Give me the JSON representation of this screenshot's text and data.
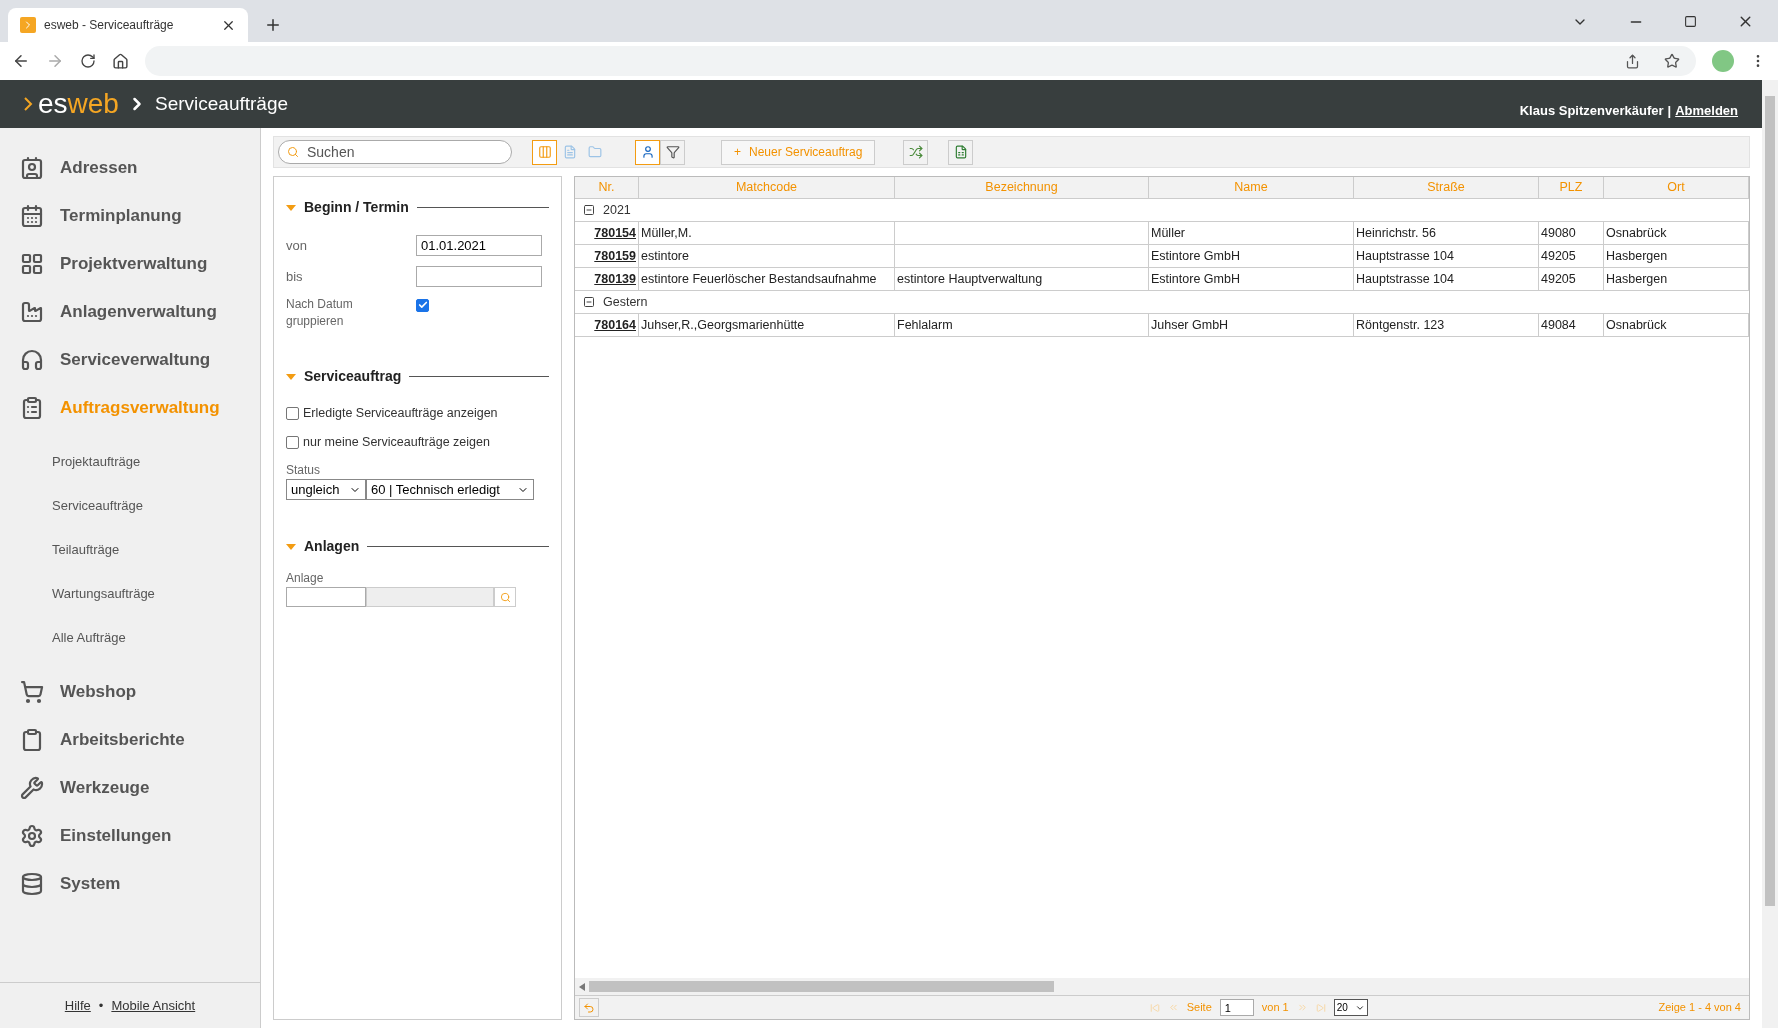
{
  "browser": {
    "tab_title": "esweb - Serviceaufträge"
  },
  "header": {
    "logo_a": "es",
    "logo_b": "web",
    "breadcrumb": "Serviceaufträge",
    "user": "Klaus Spitzenverkäufer",
    "separator": "|",
    "logout": "Abmelden"
  },
  "sidebar": {
    "items": [
      {
        "label": "Adressen",
        "selected": false
      },
      {
        "label": "Terminplanung",
        "selected": false
      },
      {
        "label": "Projektverwaltung",
        "selected": false
      },
      {
        "label": "Anlagenverwaltung",
        "selected": false
      },
      {
        "label": "Serviceverwaltung",
        "selected": false
      },
      {
        "label": "Auftragsverwaltung",
        "selected": true,
        "children": [
          {
            "label": "Projektaufträge"
          },
          {
            "label": "Serviceaufträge"
          },
          {
            "label": "Teilaufträge"
          },
          {
            "label": "Wartungsaufträge"
          },
          {
            "label": "Alle Aufträge"
          }
        ]
      },
      {
        "label": "Webshop",
        "selected": false
      },
      {
        "label": "Arbeitsberichte",
        "selected": false
      },
      {
        "label": "Werkzeuge",
        "selected": false
      },
      {
        "label": "Einstellungen",
        "selected": false
      },
      {
        "label": "System",
        "selected": false
      }
    ],
    "footer": {
      "links": [
        "Hilfe",
        "Mobile Ansicht"
      ],
      "separator": "•"
    }
  },
  "toolbar": {
    "search_placeholder": "Suchen",
    "views": [
      {
        "selected": true
      },
      {
        "selected": false
      },
      {
        "selected": false
      }
    ],
    "filters": [
      {
        "selected": true
      },
      {
        "selected": false
      }
    ],
    "new_button": {
      "icon": "+",
      "label": "Neuer Serviceauftrag"
    }
  },
  "filter": {
    "date": {
      "title": "Beginn / Termin",
      "from_label": "von",
      "from_value": "01.01.2021",
      "to_label": "bis",
      "group_label": "Nach Datum gruppieren",
      "group_checked": true
    },
    "order": {
      "title": "Serviceauftrag",
      "options": [
        {
          "label": "Erledigte Serviceaufträge anzeigen",
          "checked": false
        },
        {
          "label": "nur meine Serviceaufträge zeigen",
          "checked": false
        }
      ],
      "status_label": "Status",
      "operator": "ungleich",
      "status": "60 | Technisch erledigt"
    },
    "plant": {
      "title": "Anlagen",
      "label": "Anlage"
    }
  },
  "table": {
    "columns": [
      "Nr.",
      "Matchcode",
      "Bezeichnung",
      "Name",
      "Straße",
      "PLZ",
      "Ort"
    ],
    "groups": [
      {
        "label": "2021",
        "expanded": true,
        "rows": [
          [
            "780154",
            "Müller,M.",
            "",
            "Müller",
            "Heinrichstr. 56",
            "49080",
            "Osnabrück"
          ],
          [
            "780159",
            "estintore",
            "",
            "Estintore GmbH",
            "Hauptstrasse 104",
            "49205",
            "Hasbergen"
          ],
          [
            "780139",
            "estintore Feuerlöscher Bestandsaufnahme",
            "estintore Hauptverwaltung",
            "Estintore GmbH",
            "Hauptstrasse 104",
            "49205",
            "Hasbergen"
          ]
        ]
      },
      {
        "label": "Gestern",
        "expanded": true,
        "rows": [
          [
            "780164",
            "Juhser,R.,Georgsmarienhütte",
            "Fehlalarm",
            "Juhser GmbH",
            "Röntgenstr. 123",
            "49084",
            "Osnabrück"
          ]
        ]
      }
    ]
  },
  "pager": {
    "page_label": "Seite",
    "page": "1",
    "of": "von 1",
    "size": "20",
    "summary": "Zeige 1 - 4 von 4"
  }
}
